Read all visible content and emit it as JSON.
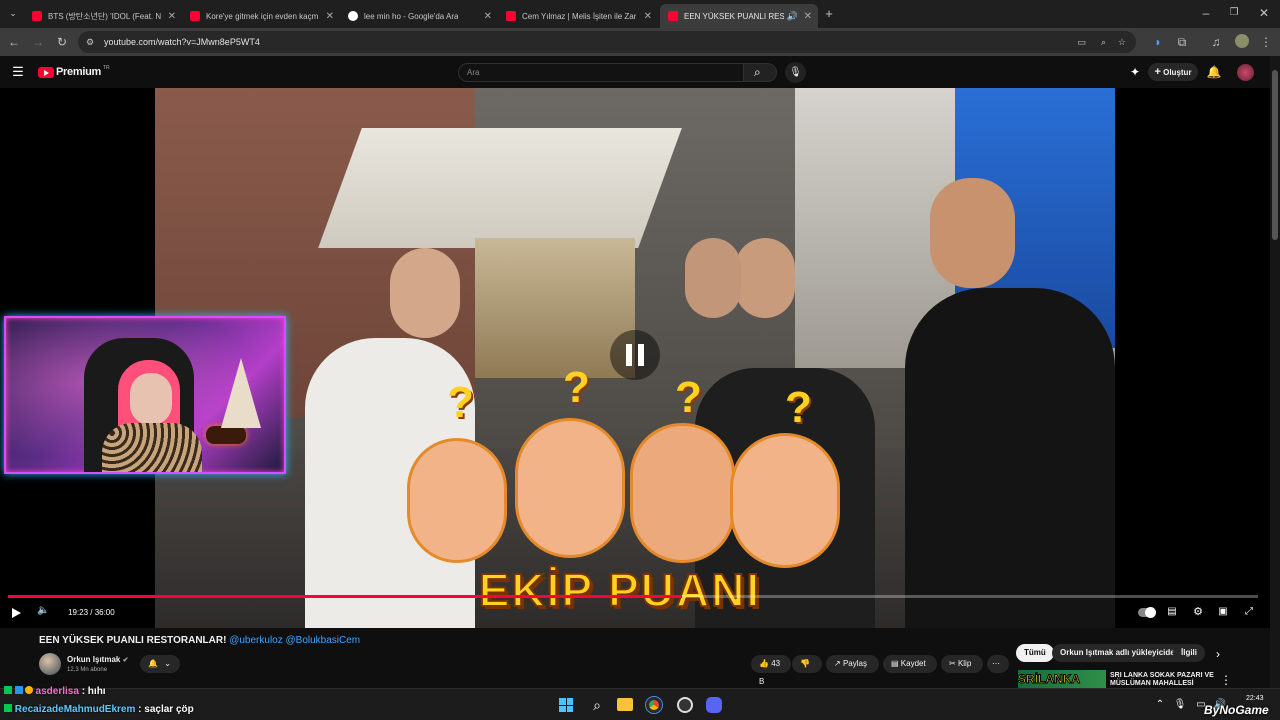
{
  "browser": {
    "tabs": [
      {
        "label": "BTS (방탄소년단) 'IDOL (Feat. N",
        "favicon": "youtube"
      },
      {
        "label": "Kore'ye gitmek için evden kaçm",
        "favicon": "youtube"
      },
      {
        "label": "lee min ho - Google'da Ara",
        "favicon": "google"
      },
      {
        "label": "Cem Yılmaz | Melis İşiten ile Zar",
        "favicon": "youtube"
      },
      {
        "label": "EEN YÜKSEK PUANLI RESTO",
        "favicon": "youtube"
      }
    ],
    "url": "youtube.com/watch?v=JMwn8eP5WT4"
  },
  "youtube": {
    "logo_text": "Premium",
    "logo_region": "TR",
    "search_placeholder": "Ara",
    "create_label": "Oluştur"
  },
  "player": {
    "time": "19:23 / 36:00",
    "progress_fraction": 0.539,
    "overlay_text": "EKİP PUANI"
  },
  "video": {
    "title": "EEN YÜKSEK PUANLI RESTORANLAR!",
    "mentions": "@uberkuloz @BolukbasiCem",
    "channel": "Orkun Işıtmak",
    "subscribers": "12,3 Mn abone",
    "likes": "43 B",
    "share": "Paylaş",
    "save": "Kaydet",
    "clip": "Klip"
  },
  "chips": [
    "Tümü",
    "Orkun Işıtmak adlı yükleyiciden",
    "İlgili"
  ],
  "recommended": {
    "thumb_text": "SRİLANKA",
    "title": "SRİ LANKA SOKAK PAZARI VE MÜSLÜMAN MAHALLESİ"
  },
  "chat": [
    {
      "user": "asderlisa",
      "message": ": hıhı",
      "color": "#ff6ec7"
    },
    {
      "user": "RecaizadeMahmudEkrem",
      "message": ": saçlar çöp",
      "color": "#5ec8ff"
    }
  ],
  "taskbar": {
    "time": "22:43",
    "watermark": "ByNoGame"
  }
}
